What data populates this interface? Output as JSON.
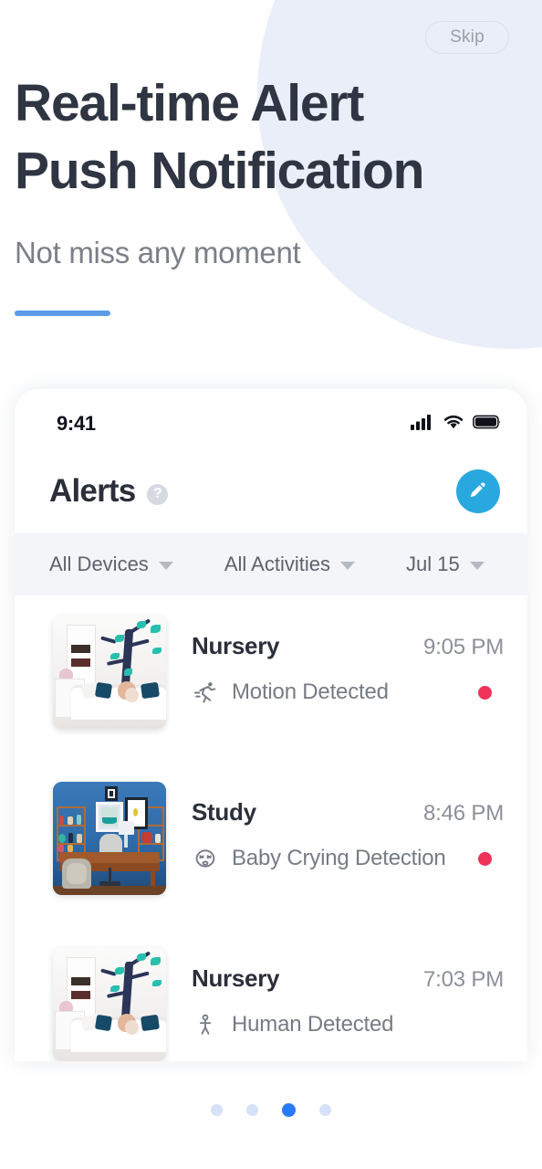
{
  "onboarding": {
    "skip_label": "Skip",
    "title_line1": "Real-time Alert",
    "title_line2": "Push Notification",
    "subtitle": "Not miss any moment",
    "accent_color": "#5b9be8",
    "circle_color": "#e9eef9",
    "title_color": "#2f3542",
    "subtitle_color": "#7b8088"
  },
  "pagination": {
    "total": 4,
    "active_index": 2,
    "active_color": "#2979ff",
    "inactive_color": "#d6e2f7"
  },
  "phone": {
    "status_bar": {
      "time": "9:41",
      "signal_icon": "cellular-signal-icon",
      "wifi_icon": "wifi-icon",
      "battery_icon": "battery-full-icon"
    },
    "app_bar": {
      "title": "Alerts",
      "help_icon": "help-question-icon",
      "help_glyph": "?",
      "edit_icon": "pencil-edit-icon",
      "edit_button_color": "#29a8e0"
    },
    "filters": [
      {
        "label": "All Devices",
        "icon": "chevron-down-icon"
      },
      {
        "label": "All Activities",
        "icon": "chevron-down-icon"
      },
      {
        "label": "Jul 15",
        "icon": "chevron-down-icon"
      }
    ],
    "alerts": [
      {
        "device": "Nursery",
        "time": "9:05 PM",
        "event": "Motion Detected",
        "event_icon": "motion-running-icon",
        "unread": true,
        "unread_color": "#f0315a",
        "thumbnail": "nursery-room-thumbnail"
      },
      {
        "device": "Study",
        "time": "8:46 PM",
        "event": "Baby Crying Detection",
        "event_icon": "baby-crying-face-icon",
        "unread": true,
        "unread_color": "#f0315a",
        "thumbnail": "study-room-thumbnail"
      },
      {
        "device": "Nursery",
        "time": "7:03 PM",
        "event": "Human Detected",
        "event_icon": "human-person-icon",
        "unread": false,
        "unread_color": "#f0315a",
        "thumbnail": "nursery-room-thumbnail"
      }
    ]
  }
}
